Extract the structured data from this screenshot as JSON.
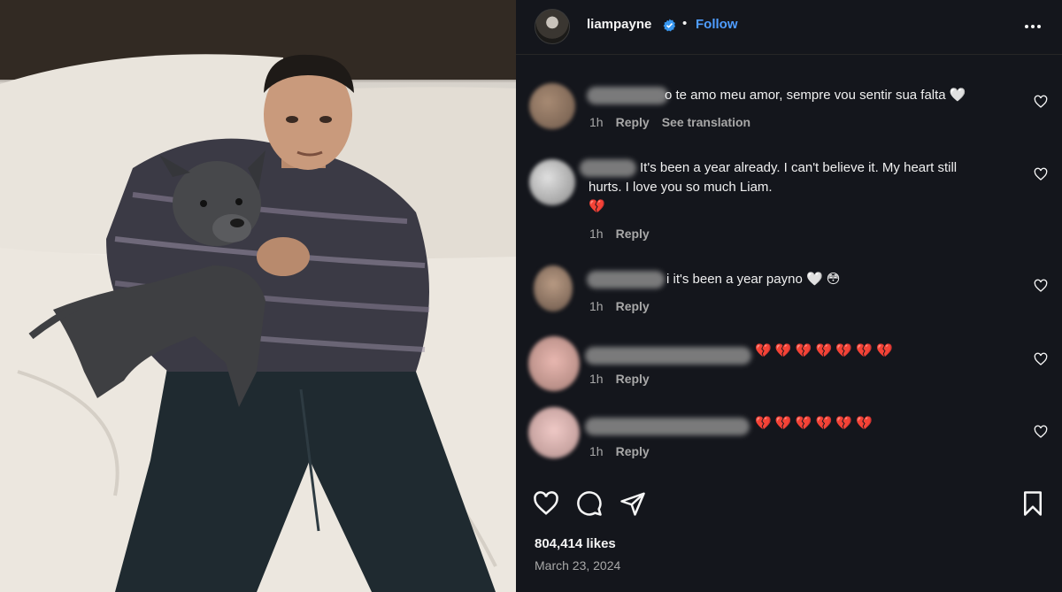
{
  "post": {
    "username": "liampayne",
    "follow_label": "Follow",
    "separator": "•",
    "likes": "804,414 likes",
    "date": "March 23, 2024"
  },
  "icons": {
    "verified": "verified-badge-icon",
    "more": "more-options-icon",
    "like": "heart-icon",
    "comment": "comment-bubble-icon",
    "share": "paper-plane-icon",
    "save": "bookmark-icon"
  },
  "colors": {
    "panel_bg": "#14161c",
    "follow": "#4f9dff",
    "verified": "#3897f0",
    "broken_heart": "#e8457a"
  },
  "comments": [
    {
      "text": "o te amo meu amor, sempre vou sentir sua falta 🤍",
      "time": "1h",
      "reply": "Reply",
      "translate": "See translation"
    },
    {
      "text_line1": "It's been a year already. I can't believe it. My heart still",
      "text_line2": "hurts. I love you so much Liam.",
      "text_line3": "💔",
      "time": "1h",
      "reply": "Reply"
    },
    {
      "text": "i it's been a year payno 🤍 😳",
      "time": "1h",
      "reply": "Reply"
    },
    {
      "text": "💔 💔 💔 💔 💔 💔 💔",
      "time": "1h",
      "reply": "Reply"
    },
    {
      "text": "💔 💔 💔 💔 💔 💔",
      "time": "1h",
      "reply": "Reply"
    }
  ]
}
